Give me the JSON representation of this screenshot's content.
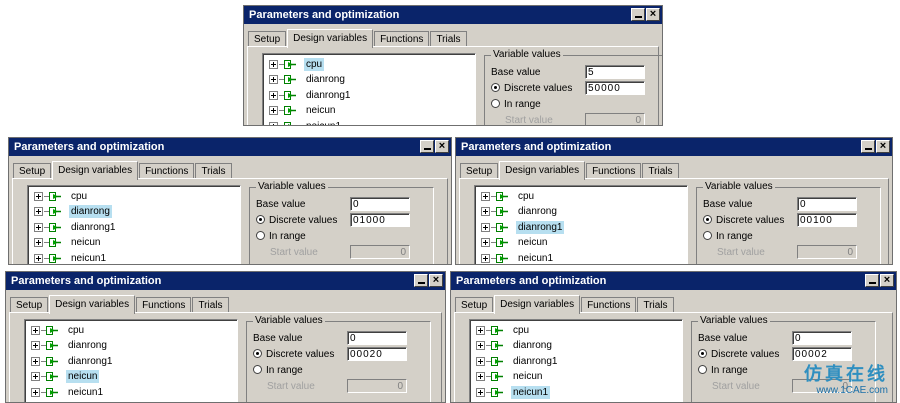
{
  "window_title": "Parameters and optimization",
  "tabs": [
    "Setup",
    "Design variables",
    "Functions",
    "Trials"
  ],
  "variables": [
    "cpu",
    "dianrong",
    "dianrong1",
    "neicun",
    "neicun1"
  ],
  "group_title": "Variable values",
  "labels": {
    "base_value": "Base value",
    "discrete_values": "Discrete values",
    "in_range": "In range",
    "start_value": "Start value"
  },
  "windows": [
    {
      "selected_variable": "cpu",
      "base_value": "5",
      "discrete_values": "50000",
      "start_value": "0"
    },
    {
      "selected_variable": "dianrong",
      "base_value": "0",
      "discrete_values": "01000",
      "start_value": "0"
    },
    {
      "selected_variable": "dianrong1",
      "base_value": "0",
      "discrete_values": "00100",
      "start_value": "0"
    },
    {
      "selected_variable": "neicun",
      "base_value": "0",
      "discrete_values": "00020",
      "start_value": "0"
    },
    {
      "selected_variable": "neicun1",
      "base_value": "0",
      "discrete_values": "00002",
      "start_value": "0"
    }
  ],
  "watermark": {
    "chinese": "仿真在线",
    "url": "www.1CAE.com"
  },
  "colors": {
    "titlebar": "#0a246a",
    "window_bg": "#d4d0c8",
    "selection": "#b7dff0"
  }
}
